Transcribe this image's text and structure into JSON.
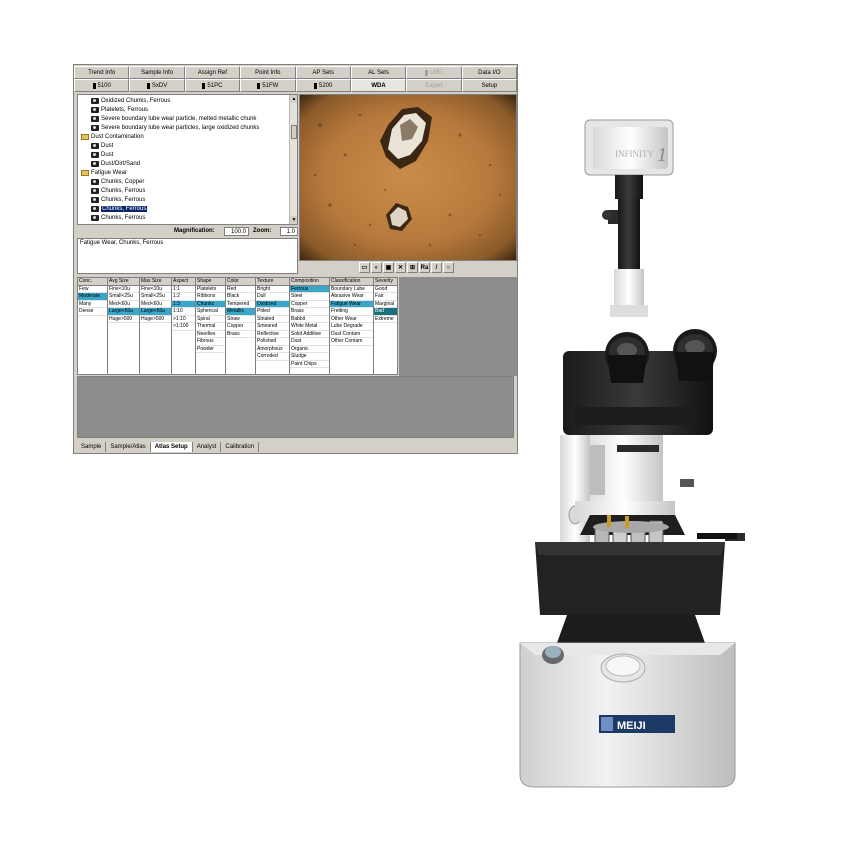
{
  "tabs_row1": [
    {
      "label": "Trend Info",
      "marker": false,
      "state": "normal"
    },
    {
      "label": "Sample Info",
      "marker": false,
      "state": "normal"
    },
    {
      "label": "Assign Ref",
      "marker": false,
      "state": "normal"
    },
    {
      "label": "Point Info",
      "marker": false,
      "state": "normal"
    },
    {
      "label": "AP Sets",
      "marker": false,
      "state": "normal"
    },
    {
      "label": "AL Sets",
      "marker": false,
      "state": "normal"
    },
    {
      "label": "LMG",
      "marker": true,
      "state": "disabled"
    },
    {
      "label": "Data I/O",
      "marker": false,
      "state": "normal"
    }
  ],
  "tabs_row2": [
    {
      "label": "5100",
      "marker": true,
      "state": "normal"
    },
    {
      "label": "SxDV",
      "marker": true,
      "state": "normal"
    },
    {
      "label": "51PC",
      "marker": true,
      "state": "normal"
    },
    {
      "label": "51FW",
      "marker": true,
      "state": "normal"
    },
    {
      "label": "5200",
      "marker": true,
      "state": "normal"
    },
    {
      "label": "WDA",
      "marker": false,
      "state": "active"
    },
    {
      "label": "Expert",
      "marker": false,
      "state": "disabled"
    },
    {
      "label": "Setup",
      "marker": false,
      "state": "normal"
    }
  ],
  "tree": [
    {
      "label": "Oxidized Chunks, Ferrous",
      "type": "leaf",
      "indent": 1,
      "selected": false
    },
    {
      "label": "Platelets, Ferrous",
      "type": "leaf",
      "indent": 1,
      "selected": false
    },
    {
      "label": "Severe boundary lube wear particle, melted metallic chunk",
      "type": "leaf",
      "indent": 1,
      "selected": false
    },
    {
      "label": "Severe boundary lube wear particles, large oxidized chunks",
      "type": "leaf",
      "indent": 1,
      "selected": false
    },
    {
      "label": "Dust Contamination",
      "type": "folder",
      "indent": 0,
      "selected": false
    },
    {
      "label": "Dust",
      "type": "leaf",
      "indent": 1,
      "selected": false
    },
    {
      "label": "Dust",
      "type": "leaf",
      "indent": 1,
      "selected": false
    },
    {
      "label": "Dust/Dirt/Sand",
      "type": "leaf",
      "indent": 1,
      "selected": false
    },
    {
      "label": "Fatigue Wear",
      "type": "folder",
      "indent": 0,
      "selected": false
    },
    {
      "label": "Chunks, Copper",
      "type": "leaf",
      "indent": 1,
      "selected": false
    },
    {
      "label": "Chunks, Ferrous",
      "type": "leaf",
      "indent": 1,
      "selected": false
    },
    {
      "label": "Chunks, Ferrous",
      "type": "leaf",
      "indent": 1,
      "selected": false
    },
    {
      "label": "Chunks, Ferrous",
      "type": "leaf",
      "indent": 1,
      "selected": true
    },
    {
      "label": "Chunks, Ferrous",
      "type": "leaf",
      "indent": 1,
      "selected": false
    }
  ],
  "magnification": {
    "label": "Magnification:",
    "value": "100.0"
  },
  "zoom": {
    "label": "Zoom:",
    "value": "1.0"
  },
  "description": "Fatigue Wear, Chunks, Ferrous",
  "image_toolbar": [
    "new-doc-icon",
    "open-icon",
    "save-icon",
    "delete-icon",
    "zoom-region-icon",
    "Ra",
    "pen-icon",
    "magnifier-icon"
  ],
  "atlas_columns": [
    {
      "header": "Conc.",
      "items": [
        "Few",
        "Moderate",
        "Many",
        "Dense"
      ],
      "highlight": [
        1
      ]
    },
    {
      "header": "Avg Size",
      "items": [
        "Fine<10u",
        "Small<25u",
        "Med<60u",
        "Large<60u",
        "Huge>500"
      ],
      "highlight": [
        3
      ]
    },
    {
      "header": "Max Size",
      "items": [
        "Fine<10u",
        "Small<25u",
        "Med<60u",
        "Large<60u",
        "Huge>500"
      ],
      "highlight": [
        3
      ]
    },
    {
      "header": "Aspect",
      "items": [
        "1:1",
        "1:2",
        "1:3",
        "1:10",
        ">1:10",
        ">1:100"
      ],
      "highlight": [
        2
      ]
    },
    {
      "header": "Shape",
      "items": [
        "Platelets",
        "Ribbons",
        "Chunks",
        "Spherical",
        "Spiral",
        "Thermal",
        "Needles",
        "Fibrous",
        "Powder"
      ],
      "highlight": [
        2
      ]
    },
    {
      "header": "Color",
      "items": [
        "Red",
        "Black",
        "Tempered",
        "Metallic",
        "Straw",
        "Copper",
        "Brass"
      ],
      "highlight": [
        3
      ]
    },
    {
      "header": "Texture",
      "items": [
        "Bright",
        "Dull",
        "Oxidized",
        "Pitted",
        "Striated",
        "Smeared",
        "Reflective",
        "Polished",
        "Amorphous",
        "Corroded"
      ],
      "highlight": [
        2
      ]
    },
    {
      "header": "Composition",
      "items": [
        "Ferrous",
        "Steel",
        "Copper",
        "Brass",
        "Babbit",
        "White Metal",
        "Solid Additive",
        "Dust",
        "Organic",
        "Sludge",
        "Paint Chips"
      ],
      "highlight": [
        0
      ]
    },
    {
      "header": "Classification",
      "items": [
        "Boundary Lube",
        "Abrasive Wear",
        "Fatigue Wear",
        "Fretting",
        "Other Wear",
        "Lube Degrade",
        "Dust Contam",
        "Other Contam"
      ],
      "highlight": [
        2
      ]
    },
    {
      "header": "Severity",
      "items": [
        "Good",
        "Fair",
        "Marginal",
        "Bad",
        "Extreme"
      ],
      "highlight": [],
      "highlight_dark": [
        3
      ]
    }
  ],
  "bottom_tabs": [
    {
      "label": "Sample",
      "active": false
    },
    {
      "label": "Sample/Atlas",
      "active": false
    },
    {
      "label": "Atlas Setup",
      "active": true
    },
    {
      "label": "Analyst",
      "active": false
    },
    {
      "label": "Calibration",
      "active": false
    }
  ],
  "microscope": {
    "brand_label": "MEIJI",
    "camera_label": "INFINITY",
    "camera_model": "1"
  },
  "colors": {
    "highlight": "#3aa7c8",
    "highlight_dark": "#19707e",
    "selection": "#0a246a",
    "window": "#d4d0c8",
    "gray_area": "#8d8d8d"
  }
}
